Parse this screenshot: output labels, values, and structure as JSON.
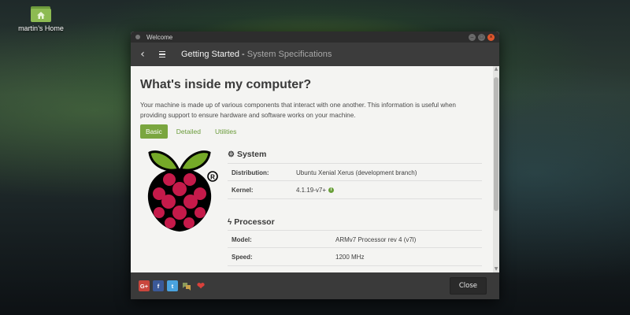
{
  "desktop": {
    "icon_label": "martin’s Home",
    "icon_name": "home-folder-icon"
  },
  "window": {
    "title": "Welcome",
    "controls": [
      "minimize",
      "maximize",
      "close"
    ]
  },
  "header": {
    "crumb_main": "Getting Started",
    "crumb_sep": " - ",
    "crumb_sub": "System Specifications"
  },
  "page": {
    "heading": "What's inside my computer?",
    "intro": "Your machine is made up of various components that interact with one another. This information is useful when providing support to ensure hardware and software works on your machine."
  },
  "tabs": [
    {
      "label": "Basic",
      "active": true
    },
    {
      "label": "Detailed",
      "active": false
    },
    {
      "label": "Utilities",
      "active": false
    }
  ],
  "system": {
    "title": "System",
    "icon": "gear-icon",
    "rows": [
      {
        "key": "Distribution:",
        "value": "Ubuntu Xenial Xerus (development branch)"
      },
      {
        "key": "Kernel:",
        "value": "4.1.19-v7+"
      }
    ]
  },
  "processor": {
    "title": "Processor",
    "icon": "bolt-icon",
    "rows": [
      {
        "key": "Model:",
        "value": "ARMv7 Processor rev 4 (v7l)"
      },
      {
        "key": "Speed:",
        "value": "1200 MHz"
      }
    ]
  },
  "footer": {
    "social": [
      "google-plus-icon",
      "facebook-icon",
      "twitter-icon",
      "forum-icon",
      "heart-icon"
    ],
    "social_glyphs": {
      "gplus": "G+",
      "fb": "f",
      "tw": "t"
    },
    "close_label": "Close"
  },
  "colors": {
    "accent": "#7aa63f",
    "header_bg": "#3c3c3c",
    "close_red": "#e0562c",
    "raspberry_leaf": "#75a928",
    "raspberry_red": "#c51a4a"
  }
}
